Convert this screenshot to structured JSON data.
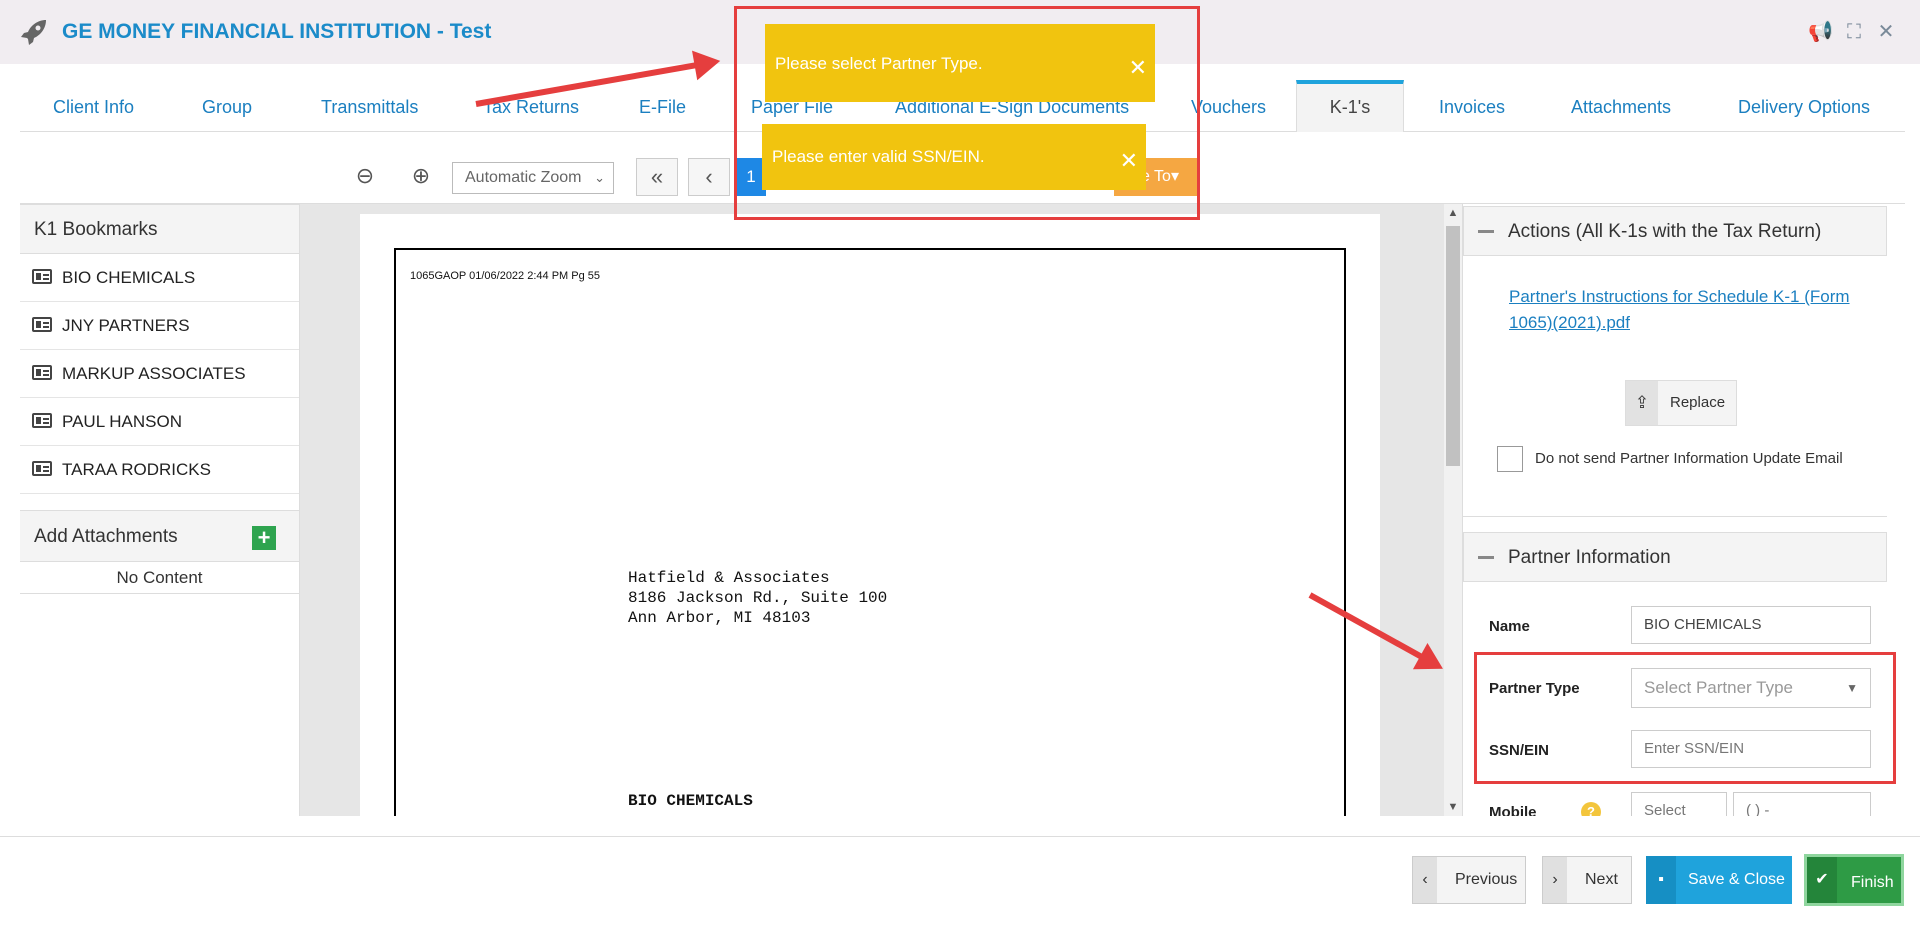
{
  "app": {
    "title": "GE MONEY FINANCIAL INSTITUTION - Test"
  },
  "tabs": [
    {
      "label": "Client Info"
    },
    {
      "label": "Group"
    },
    {
      "label": "Transmittals"
    },
    {
      "label": "Tax Returns"
    },
    {
      "label": "E-File"
    },
    {
      "label": "Paper File"
    },
    {
      "label": "Additional E-Sign Documents"
    },
    {
      "label": "Vouchers"
    },
    {
      "label": "K-1's"
    },
    {
      "label": "Invoices"
    },
    {
      "label": "Attachments"
    },
    {
      "label": "Delivery Options"
    }
  ],
  "toolbar": {
    "zoom_value": "Automatic Zoom",
    "page_number": "1",
    "move_to_label": "ve To▾"
  },
  "bookmarks": {
    "header": "K1 Bookmarks",
    "items": [
      {
        "label": "BIO CHEMICALS"
      },
      {
        "label": "JNY PARTNERS"
      },
      {
        "label": "MARKUP ASSOCIATES"
      },
      {
        "label": "PAUL HANSON"
      },
      {
        "label": "TARAA RODRICKS"
      }
    ]
  },
  "attachments": {
    "header": "Add Attachments",
    "empty_text": "No Content"
  },
  "document": {
    "header_line": "1065GAOP 01/06/2022 2:44 PM Pg 55",
    "address": [
      "Hatfield & Associates",
      "8186 Jackson Rd., Suite 100",
      "Ann Arbor, MI 48103"
    ],
    "recipient": "BIO CHEMICALS"
  },
  "actions": {
    "header": "Actions (All K-1s with the Tax Return)",
    "instructions_link": "Partner's Instructions for Schedule K-1 (Form 1065)(2021).pdf",
    "replace_label": "Replace",
    "checkbox_label": "Do not send Partner Information Update Email",
    "checkbox_checked": false
  },
  "partner": {
    "header": "Partner Information",
    "name_label": "Name",
    "name_value": "BIO CHEMICALS",
    "type_label": "Partner Type",
    "type_placeholder": "Select Partner Type",
    "ssn_label": "SSN/EIN",
    "ssn_placeholder": "Enter SSN/EIN",
    "mobile_label": "Mobile",
    "mobile_select": "Select",
    "mobile_number": "( ) -"
  },
  "toasts": [
    {
      "message": "Please select Partner Type."
    },
    {
      "message": "Please enter valid SSN/EIN."
    }
  ],
  "footer": {
    "previous_label": "Previous",
    "next_label": "Next",
    "save_close_label": "Save & Close",
    "finish_label": "Finish"
  },
  "colors": {
    "brand": "#1b8bc9",
    "toast": "#f1c40f",
    "annotation": "#e53e3e",
    "finish": "#2e9b45",
    "save": "#1fa3dc"
  }
}
